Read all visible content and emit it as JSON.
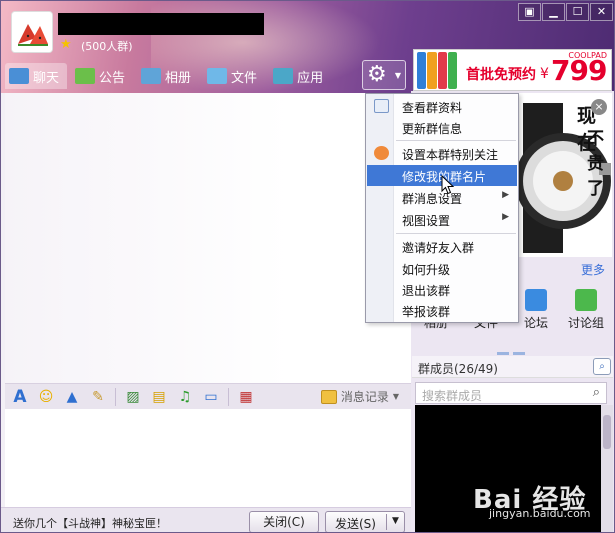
{
  "header": {
    "member_limit": "(500人群)",
    "window_controls": [
      "▣",
      "▁",
      "☐",
      "✕"
    ]
  },
  "tabs": [
    {
      "label": "聊天",
      "icon": "chat-icon",
      "color": "#ffffff"
    },
    {
      "label": "公告",
      "icon": "announcement-icon",
      "color": "#ffffff"
    },
    {
      "label": "相册",
      "icon": "album-icon",
      "color": "#ffffff"
    },
    {
      "label": "文件",
      "icon": "folder-icon",
      "color": "#ffffff"
    },
    {
      "label": "应用",
      "icon": "apps-icon",
      "color": "#ffffff"
    }
  ],
  "ad_banner": {
    "text": "首批免预约",
    "currency": "¥",
    "price": "799",
    "logo": "COOLPAD"
  },
  "context_menu": {
    "items": [
      {
        "label": "查看群资料",
        "icon": "info-card-icon"
      },
      {
        "label": "更新群信息"
      },
      {
        "label": "设置本群特别关注",
        "icon": "special-follow-icon"
      },
      {
        "label": "修改我的群名片",
        "highlighted": true
      },
      {
        "label": "群消息设置",
        "has_submenu": true
      },
      {
        "label": "视图设置",
        "has_submenu": true
      },
      {
        "label": "邀请好友入群"
      },
      {
        "label": "如何升级"
      },
      {
        "label": "退出该群"
      },
      {
        "label": "举报该群"
      }
    ]
  },
  "ad_watch": {
    "line1": "现在",
    "line2": "不贵了",
    "close": "×"
  },
  "right_panel": {
    "more": "更多",
    "apps": [
      {
        "label": "相册",
        "icon": "album-app-icon"
      },
      {
        "label": "文件",
        "icon": "file-app-icon"
      },
      {
        "label": "论坛",
        "icon": "forum-app-icon"
      },
      {
        "label": "讨论组",
        "icon": "discussion-app-icon"
      }
    ],
    "members_title": "群成员(26/49)",
    "search_placeholder": "搜索群成员"
  },
  "toolbar": {
    "history": "消息记录"
  },
  "footer": {
    "promo": "送你几个【斗战神】神秘宝匣！",
    "close_label": "关闭(C)",
    "send_label": "发送(S)"
  },
  "watermark": {
    "brand": "Bai 经验",
    "url": "jingyan.baidu.com"
  }
}
